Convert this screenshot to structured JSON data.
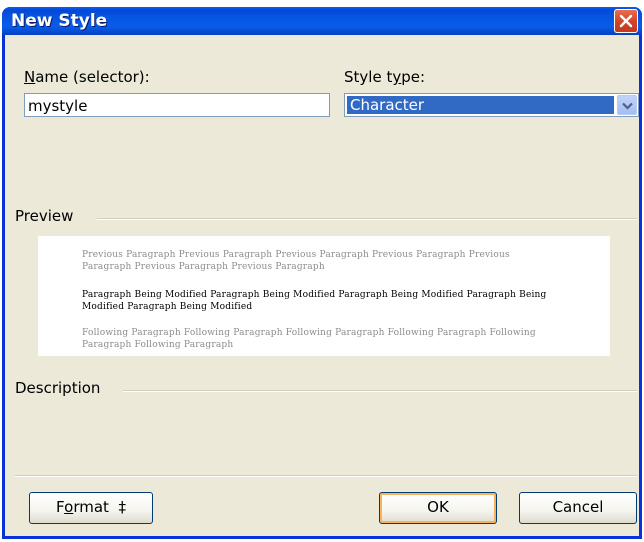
{
  "window": {
    "title": "New Style"
  },
  "fields": {
    "name_label_prefix": "N",
    "name_label_rest": "ame (selector):",
    "name_value": "mystyle",
    "type_label_prefix": "Style t",
    "type_label_u": "y",
    "type_label_rest": "pe:",
    "type_value": "Character"
  },
  "preview": {
    "label": "Preview",
    "previous_paragraph": "Previous Paragraph Previous Paragraph Previous Paragraph Previous Paragraph Previous Paragraph Previous Paragraph Previous Paragraph",
    "modified_paragraph": "Paragraph Being Modified Paragraph Being Modified Paragraph Being Modified Paragraph Being Modified Paragraph Being Modified",
    "following_paragraph": "Following Paragraph Following Paragraph Following Paragraph Following Paragraph Following Paragraph Following Paragraph"
  },
  "description": {
    "label": "Description"
  },
  "buttons": {
    "format_prefix": "F",
    "format_u": "o",
    "format_rest": "rmat",
    "format_arrow": "‡",
    "ok": "OK",
    "cancel": "Cancel"
  },
  "colors": {
    "title_bar": "#0553e0",
    "dialog_bg": "#ece9d8",
    "selection": "#316ac5",
    "close_button": "#d4452a"
  },
  "icons": {
    "close": "close-icon",
    "dropdown": "chevron-down-icon"
  }
}
